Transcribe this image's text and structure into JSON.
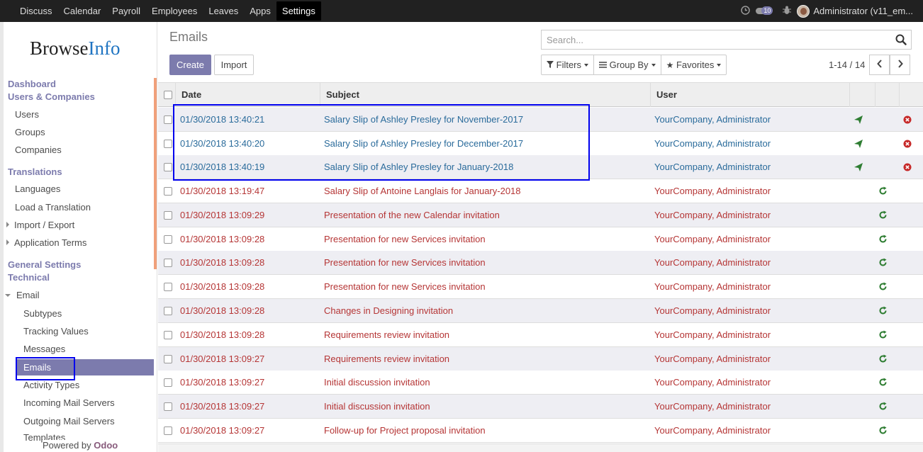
{
  "topnav": {
    "items": [
      "Discuss",
      "Calendar",
      "Payroll",
      "Employees",
      "Leaves",
      "Apps",
      "Settings"
    ],
    "active": "Settings",
    "message_count": "10",
    "user": "Administrator (v11_em..."
  },
  "sidebar": {
    "logo_a": "Browse",
    "logo_b": "Info",
    "items": [
      {
        "label": "Dashboard",
        "kind": "head"
      },
      {
        "label": "Users & Companies",
        "kind": "head"
      },
      {
        "label": "Users",
        "kind": "sub"
      },
      {
        "label": "Groups",
        "kind": "sub"
      },
      {
        "label": "Companies",
        "kind": "sub"
      },
      {
        "label": "Translations",
        "kind": "head"
      },
      {
        "label": "Languages",
        "kind": "sub"
      },
      {
        "label": "Load a Translation",
        "kind": "sub"
      },
      {
        "label": "Import / Export",
        "kind": "sub-collapsed"
      },
      {
        "label": "Application Terms",
        "kind": "sub-collapsed"
      },
      {
        "label": "General Settings",
        "kind": "head"
      },
      {
        "label": "Technical",
        "kind": "head"
      },
      {
        "label": "Email",
        "kind": "sub-expanded"
      },
      {
        "label": "Subtypes",
        "kind": "subsub"
      },
      {
        "label": "Tracking Values",
        "kind": "subsub"
      },
      {
        "label": "Messages",
        "kind": "subsub"
      },
      {
        "label": "Emails",
        "kind": "subsub-active"
      },
      {
        "label": "Activity Types",
        "kind": "subsub"
      },
      {
        "label": "Incoming Mail Servers",
        "kind": "subsub"
      },
      {
        "label": "Outgoing Mail Servers",
        "kind": "subsub"
      },
      {
        "label": "Templates",
        "kind": "subsub"
      }
    ],
    "powered_by": "Powered by",
    "powered_brand": "Odoo"
  },
  "control_panel": {
    "title": "Emails",
    "create_label": "Create",
    "import_label": "Import",
    "search_placeholder": "Search...",
    "filters_label": "Filters",
    "groupby_label": "Group By",
    "favorites_label": "Favorites",
    "pager": "1-14 / 14"
  },
  "table": {
    "columns": [
      "Date",
      "Subject",
      "User"
    ],
    "rows": [
      {
        "date": "01/30/2018 13:40:21",
        "subject": "Salary Slip of Ashley Presley for November-2017",
        "user": "YourCompany, Administrator",
        "state": "sent"
      },
      {
        "date": "01/30/2018 13:40:20",
        "subject": "Salary Slip of Ashley Presley for December-2017",
        "user": "YourCompany, Administrator",
        "state": "sent"
      },
      {
        "date": "01/30/2018 13:40:19",
        "subject": "Salary Slip of Ashley Presley for January-2018",
        "user": "YourCompany, Administrator",
        "state": "sent"
      },
      {
        "date": "01/30/2018 13:19:47",
        "subject": "Salary Slip of Antoine Langlais for January-2018",
        "user": "YourCompany, Administrator",
        "state": "exception"
      },
      {
        "date": "01/30/2018 13:09:29",
        "subject": "Presentation of the new Calendar invitation",
        "user": "YourCompany, Administrator",
        "state": "exception"
      },
      {
        "date": "01/30/2018 13:09:28",
        "subject": "Presentation for new Services invitation",
        "user": "YourCompany, Administrator",
        "state": "exception"
      },
      {
        "date": "01/30/2018 13:09:28",
        "subject": "Presentation for new Services invitation",
        "user": "YourCompany, Administrator",
        "state": "exception"
      },
      {
        "date": "01/30/2018 13:09:28",
        "subject": "Presentation for new Services invitation",
        "user": "YourCompany, Administrator",
        "state": "exception"
      },
      {
        "date": "01/30/2018 13:09:28",
        "subject": "Changes in Designing invitation",
        "user": "YourCompany, Administrator",
        "state": "exception"
      },
      {
        "date": "01/30/2018 13:09:28",
        "subject": "Requirements review invitation",
        "user": "YourCompany, Administrator",
        "state": "exception"
      },
      {
        "date": "01/30/2018 13:09:27",
        "subject": "Requirements review invitation",
        "user": "YourCompany, Administrator",
        "state": "exception"
      },
      {
        "date": "01/30/2018 13:09:27",
        "subject": "Initial discussion invitation",
        "user": "YourCompany, Administrator",
        "state": "exception"
      },
      {
        "date": "01/30/2018 13:09:27",
        "subject": "Initial discussion invitation",
        "user": "YourCompany, Administrator",
        "state": "exception"
      },
      {
        "date": "01/30/2018 13:09:27",
        "subject": "Follow-up for Project proposal invitation",
        "user": "YourCompany, Administrator",
        "state": "exception"
      }
    ]
  },
  "colors": {
    "brand": "#7c7bad",
    "sent_text": "#2a6b9b",
    "exception_text": "#b53535",
    "send_icon": "#2e7d32",
    "cancel_icon": "#c62828",
    "retry_icon": "#2e7d32",
    "annotation": "#0000ee"
  },
  "icons": {
    "send": "paper-plane-icon",
    "cancel": "cancel-icon",
    "retry": "retry-icon"
  }
}
